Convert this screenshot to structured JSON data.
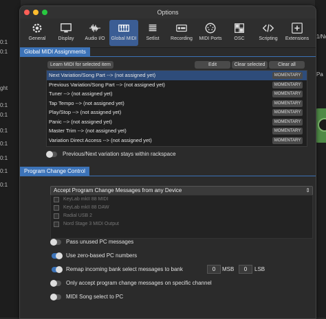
{
  "background": {
    "left_texts": [
      "0:1",
      "0:1",
      "ght",
      "0:1",
      "0:1",
      "0:1",
      "0:1",
      "0:1",
      "0:1",
      "0:1"
    ],
    "right_texts": [
      "1/Noi",
      "Pa"
    ]
  },
  "window": {
    "title": "Options"
  },
  "toolbar": {
    "tabs": [
      {
        "label": "General",
        "icon": "gear-icon"
      },
      {
        "label": "Display",
        "icon": "monitor-icon"
      },
      {
        "label": "Audio I/O",
        "icon": "waveform-icon"
      },
      {
        "label": "Global MIDI",
        "icon": "keyboard-icon"
      },
      {
        "label": "Setlist",
        "icon": "list-icon"
      },
      {
        "label": "Recording",
        "icon": "record-icon"
      },
      {
        "label": "MIDI Ports",
        "icon": "midi-port-icon"
      },
      {
        "label": "OSC",
        "icon": "grid-icon"
      },
      {
        "label": "Scripting",
        "icon": "code-icon"
      },
      {
        "label": "Extensions",
        "icon": "plus-icon"
      }
    ],
    "active": "Global MIDI"
  },
  "global_midi": {
    "header": "Global MIDI Assignments",
    "learn_label": "Learn MIDI for selected item",
    "edit_label": "Edit",
    "clear_selected_label": "Clear selected",
    "clear_all_label": "Clear all",
    "items": [
      {
        "label": "Next Variation/Song Part --> (not assigned yet)",
        "mode": "MOMENTARY"
      },
      {
        "label": "Previous Variation/Song Part --> (not assigned yet)",
        "mode": "MOMENTARY"
      },
      {
        "label": "Tuner --> (not assigned yet)",
        "mode": "MOMENTARY"
      },
      {
        "label": "Tap Tempo --> (not assigned yet)",
        "mode": "MOMENTARY"
      },
      {
        "label": "Play/Stop --> (not assigned yet)",
        "mode": "MOMENTARY"
      },
      {
        "label": "Panic --> (not assigned yet)",
        "mode": "MOMENTARY"
      },
      {
        "label": "Master Trim --> (not assigned yet)",
        "mode": "MOMENTARY"
      },
      {
        "label": "Variation Direct Access --> (not assigned yet)",
        "mode": "MOMENTARY"
      }
    ],
    "wrap_toggle_label": "Previous/Next variation stays within rackspace"
  },
  "program_change": {
    "header": "Program Change Control",
    "device_select": "Accept Program Change Messages from any Device",
    "devices": [
      "KeyLab mkII 88 MIDI",
      "KeyLab mkII 88 DAW",
      "Radial USB 2",
      "Nord Stage 3 MIDI Output"
    ],
    "pass_unused_label": "Pass unused PC messages",
    "zero_based_label": "Use zero-based PC numbers",
    "remap_label": "Remap incoming bank select messages  to bank",
    "msb_value": "0",
    "msb_label": "MSB",
    "lsb_value": "0",
    "lsb_label": "LSB",
    "specific_channel_label": "Only accept program change messages on specific channel",
    "midi_song_label": "MIDI Song select to PC"
  },
  "colors": {
    "accent": "#3c73b8",
    "selected_row": "#2e4c7a"
  }
}
